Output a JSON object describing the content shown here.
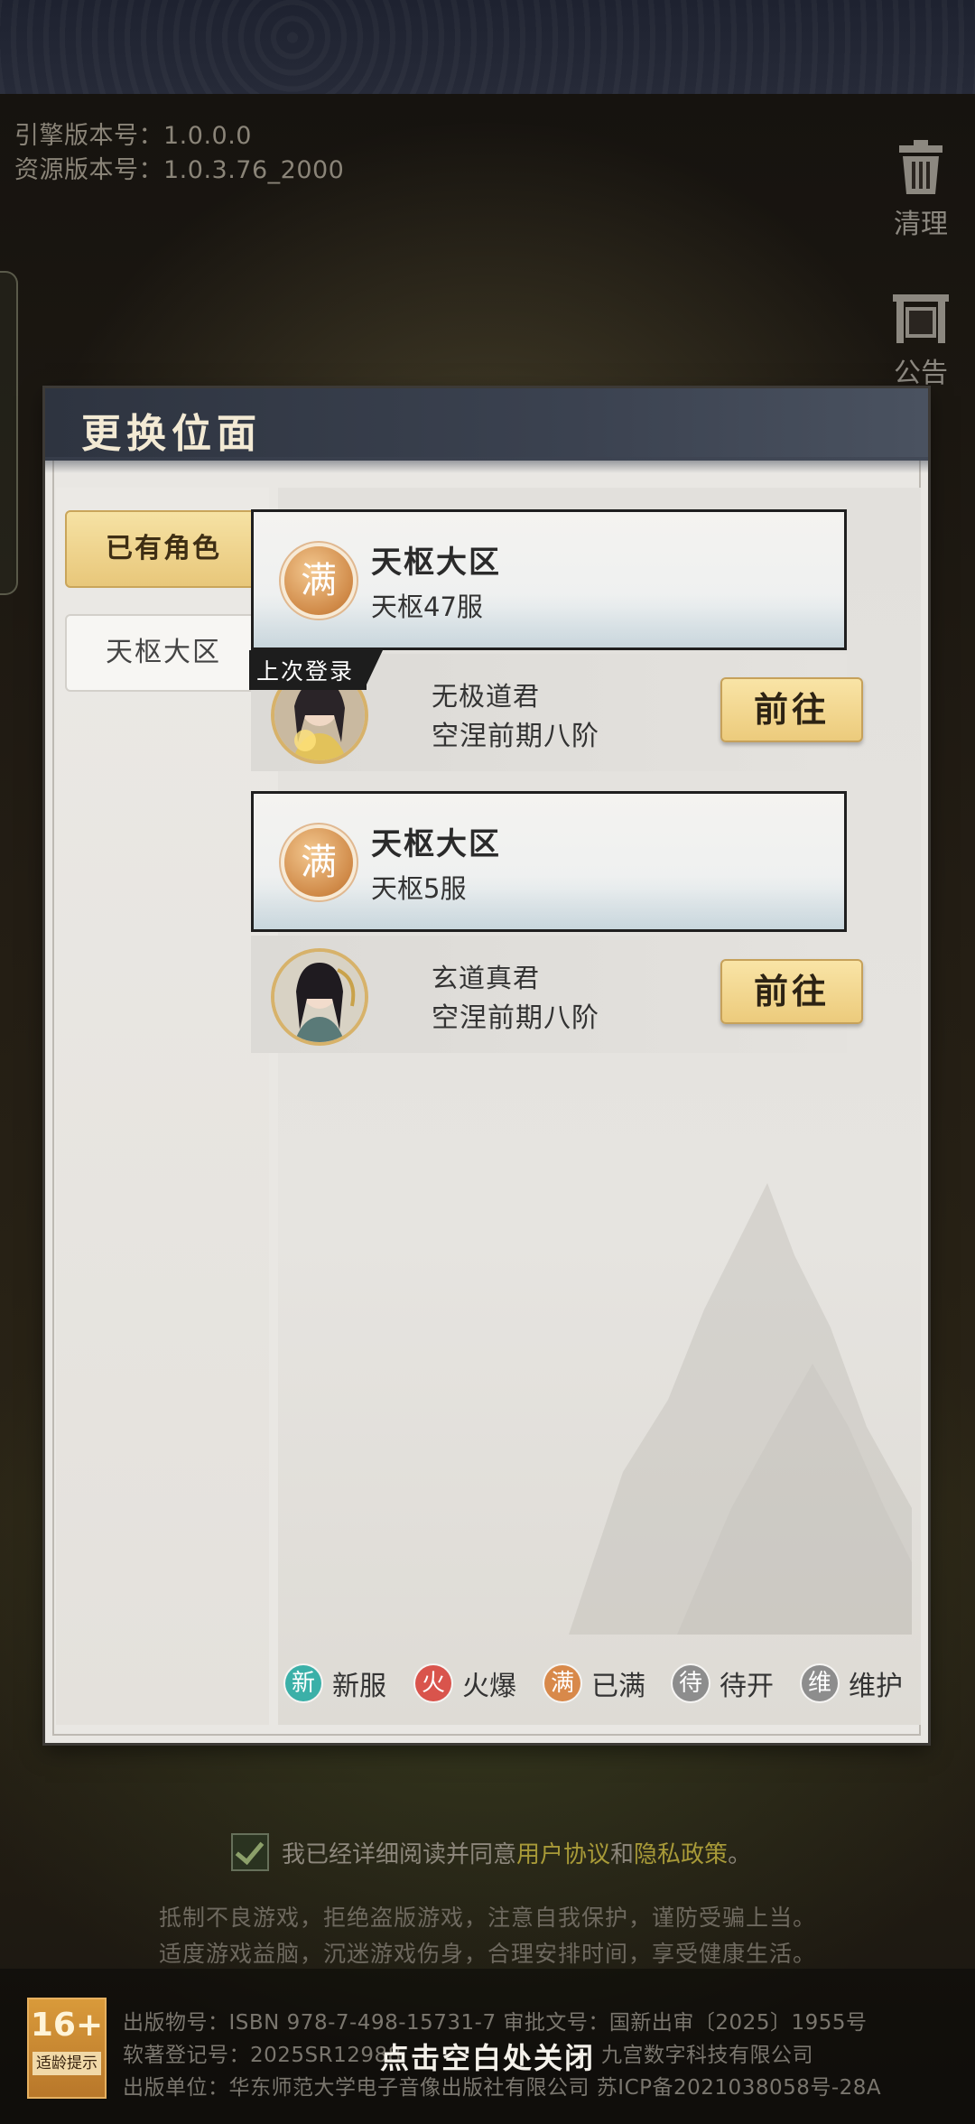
{
  "version": {
    "engine": "引擎版本号：1.0.0.0",
    "resource": "资源版本号：1.0.3.76_2000"
  },
  "tools": {
    "clean_label": "清理",
    "notice_label": "公告"
  },
  "dialog": {
    "title": "更换位面",
    "tabs": [
      {
        "label": "已有角色",
        "active": true
      },
      {
        "label": "天枢大区",
        "active": false
      }
    ],
    "servers": [
      {
        "badge": "满",
        "zone": "天枢大区",
        "server": "天枢47服",
        "last_login_tag": "上次登录",
        "character": "无极道君",
        "realm": "空涅前期八阶",
        "button": "前往"
      },
      {
        "badge": "满",
        "zone": "天枢大区",
        "server": "天枢5服",
        "character": "玄道真君",
        "realm": "空涅前期八阶",
        "button": "前往"
      }
    ],
    "legend": [
      {
        "glyph": "新",
        "label": "新服",
        "color": "#3bb0a8"
      },
      {
        "glyph": "火",
        "label": "火爆",
        "color": "#d9544c"
      },
      {
        "glyph": "满",
        "label": "已满",
        "color": "#d8894a"
      },
      {
        "glyph": "待",
        "label": "待开",
        "color": "#8d8d8d"
      },
      {
        "glyph": "维",
        "label": "维护",
        "color": "#8d8d8d"
      }
    ]
  },
  "agreement": {
    "prefix": "我已经详细阅读并同意",
    "user_agreement": "用户协议",
    "and": "和",
    "privacy_policy": "隐私政策",
    "suffix": "。"
  },
  "health_notice": [
    "抵制不良游戏，拒绝盗版游戏，注意自我保护，谨防受骗上当。",
    "适度游戏益脑，沉迷游戏伤身，合理安排时间，享受健康生活。"
  ],
  "footer": {
    "age_rating": "16+",
    "age_label": "适龄提示",
    "line1": "出版物号：ISBN 978-7-498-15731-7 审批文号：国新出审〔2025〕1955号",
    "line2": "软著登记号：2025SR12988",
    "line2_right": "九宫数字科技有限公司",
    "line3": "出版单位：华东师范大学电子音像出版社有限公司 苏ICP备2021038058号-28A",
    "close_hint": "点击空白处关闭"
  }
}
